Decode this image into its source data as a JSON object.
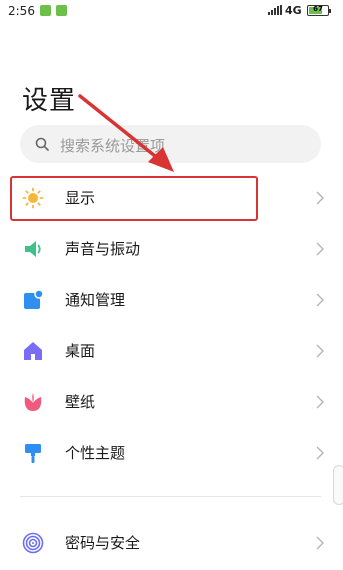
{
  "status_bar": {
    "time": "2:56",
    "network": "4G",
    "battery": "67",
    "battery_level": 0.67
  },
  "page": {
    "title": "设置"
  },
  "search": {
    "placeholder": "搜索系统设置项"
  },
  "settings_items": [
    {
      "label": "显示",
      "icon": "sun-icon",
      "color": "#f5b73b"
    },
    {
      "label": "声音与振动",
      "icon": "speaker-icon",
      "color": "#3ec28a"
    },
    {
      "label": "通知管理",
      "icon": "notification-icon",
      "color": "#2f8ff0"
    },
    {
      "label": "桌面",
      "icon": "home-icon",
      "color": "#7b6cf6"
    },
    {
      "label": "壁纸",
      "icon": "flower-icon",
      "color": "#f05a7e"
    },
    {
      "label": "个性主题",
      "icon": "brush-icon",
      "color": "#2f8ff0"
    },
    {
      "label": "密码与安全",
      "icon": "fingerprint-icon",
      "color": "#6b6ef2"
    }
  ],
  "annotation": {
    "color": "#d93434"
  }
}
